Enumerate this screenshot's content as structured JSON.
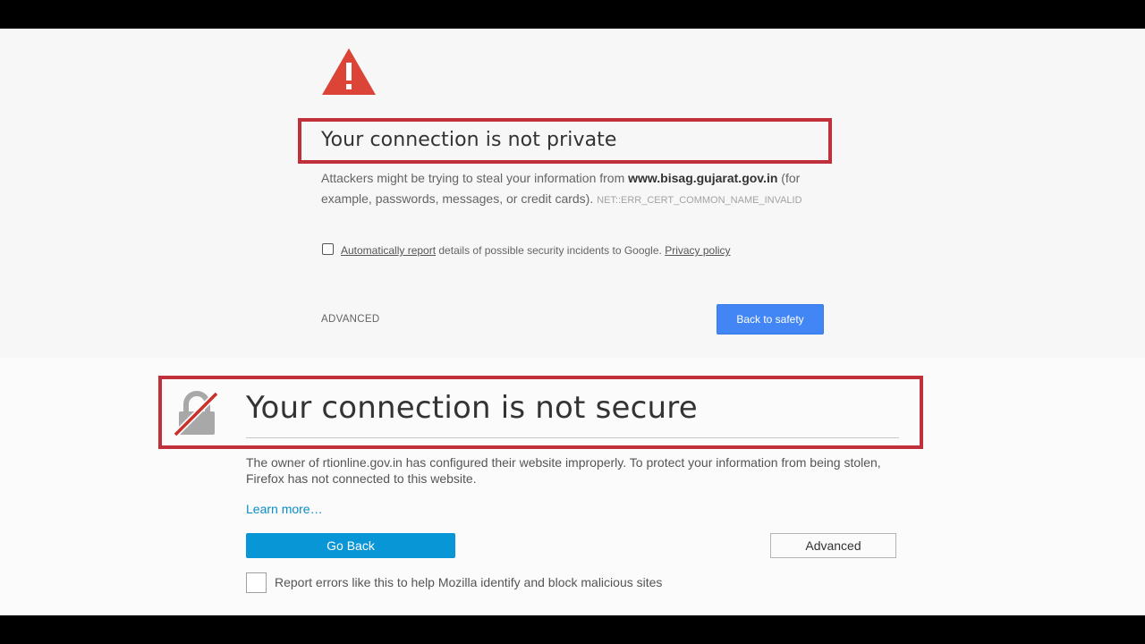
{
  "chrome": {
    "title": "Your connection is not private",
    "body_prefix": "Attackers might be trying to steal your information from ",
    "domain": "www.bisag.gujarat.gov.in",
    "body_suffix": " (for example, passwords, messages, or credit cards).",
    "error_code": "NET::ERR_CERT_COMMON_NAME_INVALID",
    "report_link": "Automatically report",
    "report_text": " details of possible security incidents to Google. ",
    "privacy_link": "Privacy policy",
    "advanced": "ADVANCED",
    "back_button": "Back to safety",
    "warning_icon": "warning-triangle",
    "accent": "#4285f4",
    "warning_color": "#db4437"
  },
  "firefox": {
    "title": "Your connection is not secure",
    "body": "The owner of rtionline.gov.in has configured their website improperly. To protect your information from being stolen, Firefox has not connected to this website.",
    "learn_more": "Learn more…",
    "go_back": "Go Back",
    "advanced": "Advanced",
    "report_label": "Report errors like this to help Mozilla identify and block malicious sites",
    "lock_icon": "broken-lock",
    "accent": "#0996d6"
  },
  "highlight_color": "#c0303a"
}
